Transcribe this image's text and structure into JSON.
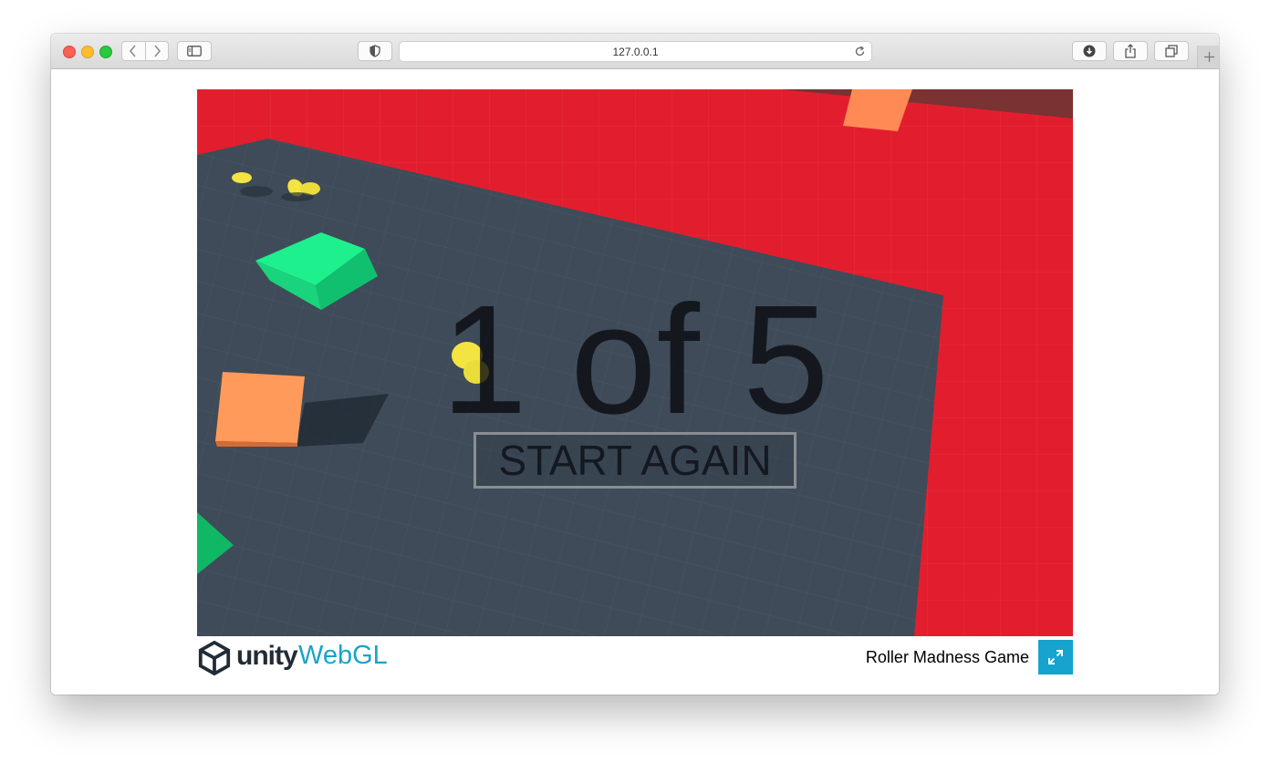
{
  "browser": {
    "url": "127.0.0.1"
  },
  "game": {
    "progress_text": "1 of 5",
    "start_again_label": "START AGAIN"
  },
  "footer": {
    "unity_label": "unity",
    "webgl_label": "WebGL",
    "game_title": "Roller Madness Game"
  },
  "colors": {
    "arena_red": "#e21e2e",
    "floor_slate": "#3f4b58",
    "cube_green": "#1ae28a",
    "block_orange": "#ff9a5a",
    "coin_yellow": "#f4e441",
    "unity_blue": "#1aa4c8"
  },
  "icons": [
    "back-icon",
    "forward-icon",
    "sidebar-icon",
    "privacy-shield-icon",
    "reload-icon",
    "download-icon",
    "share-icon",
    "tabs-icon",
    "new-tab-icon",
    "unity-logo-icon",
    "fullscreen-icon"
  ]
}
